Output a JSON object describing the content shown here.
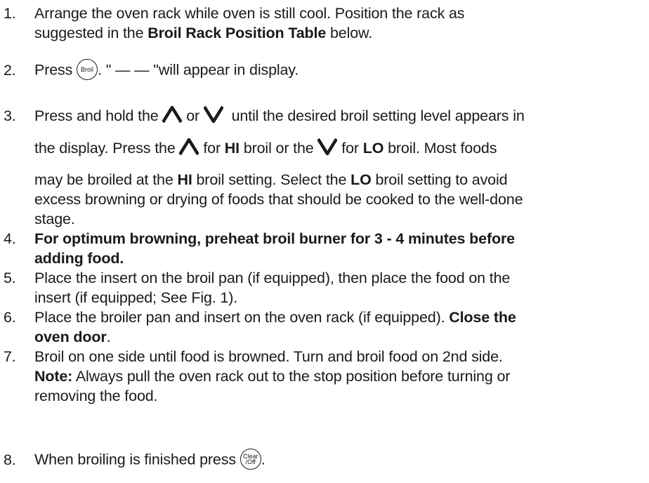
{
  "steps": [
    {
      "n": "1.",
      "lines": [
        "Arrange the oven rack while oven is still cool. Position the rack as",
        "suggested in the |Broil Rack Position Table| below."
      ]
    },
    {
      "n": "2.",
      "pre": "Press",
      "button": "Broil",
      "post": ". \" — — \"will appear in display."
    },
    {
      "n": "3.",
      "l1_a": "Press and hold the",
      "l1_b": "or",
      "l1_c": "until the desired broil setting level appears in",
      "l2_a": "the display. Press the",
      "l2_b": "for",
      "l2_hi": "HI",
      "l2_c": "broil or the",
      "l2_d": "for",
      "l2_lo": "LO",
      "l2_e": "broil. Most foods",
      "l3_a": "may be broiled at the",
      "l3_hi": "HI",
      "l3_b": "broil setting. Select the",
      "l3_lo": "LO",
      "l3_c": "broil setting to avoid",
      "l4": "excess browning or drying of foods that should be cooked to the well-done",
      "l5": "stage."
    },
    {
      "n": "4.",
      "lines": [
        "|For optimum browning, preheat broil burner for 3 - 4 minutes before|",
        "|adding food.|"
      ]
    },
    {
      "n": "5.",
      "lines": [
        "Place the insert on the broil pan (if equipped), then place the food on the",
        "insert (if equipped; See Fig. 1)."
      ]
    },
    {
      "n": "6.",
      "lines": [
        "Place the broiler pan and insert on the oven rack (if equipped). |Close the|",
        "|oven door|."
      ]
    },
    {
      "n": "7.",
      "lines": [
        "Broil on one side until food is browned. Turn and broil food on 2nd side.",
        "|Note:| Always pull the oven rack out to the stop position before turning or",
        "removing the food."
      ]
    },
    {
      "n": "8.",
      "pre": "When broiling is finished press",
      "button_l1": "Clear",
      "button_l2": "/Off",
      "post": "."
    }
  ],
  "icons": {
    "up": "up-arrow-icon",
    "down": "down-arrow-icon"
  }
}
